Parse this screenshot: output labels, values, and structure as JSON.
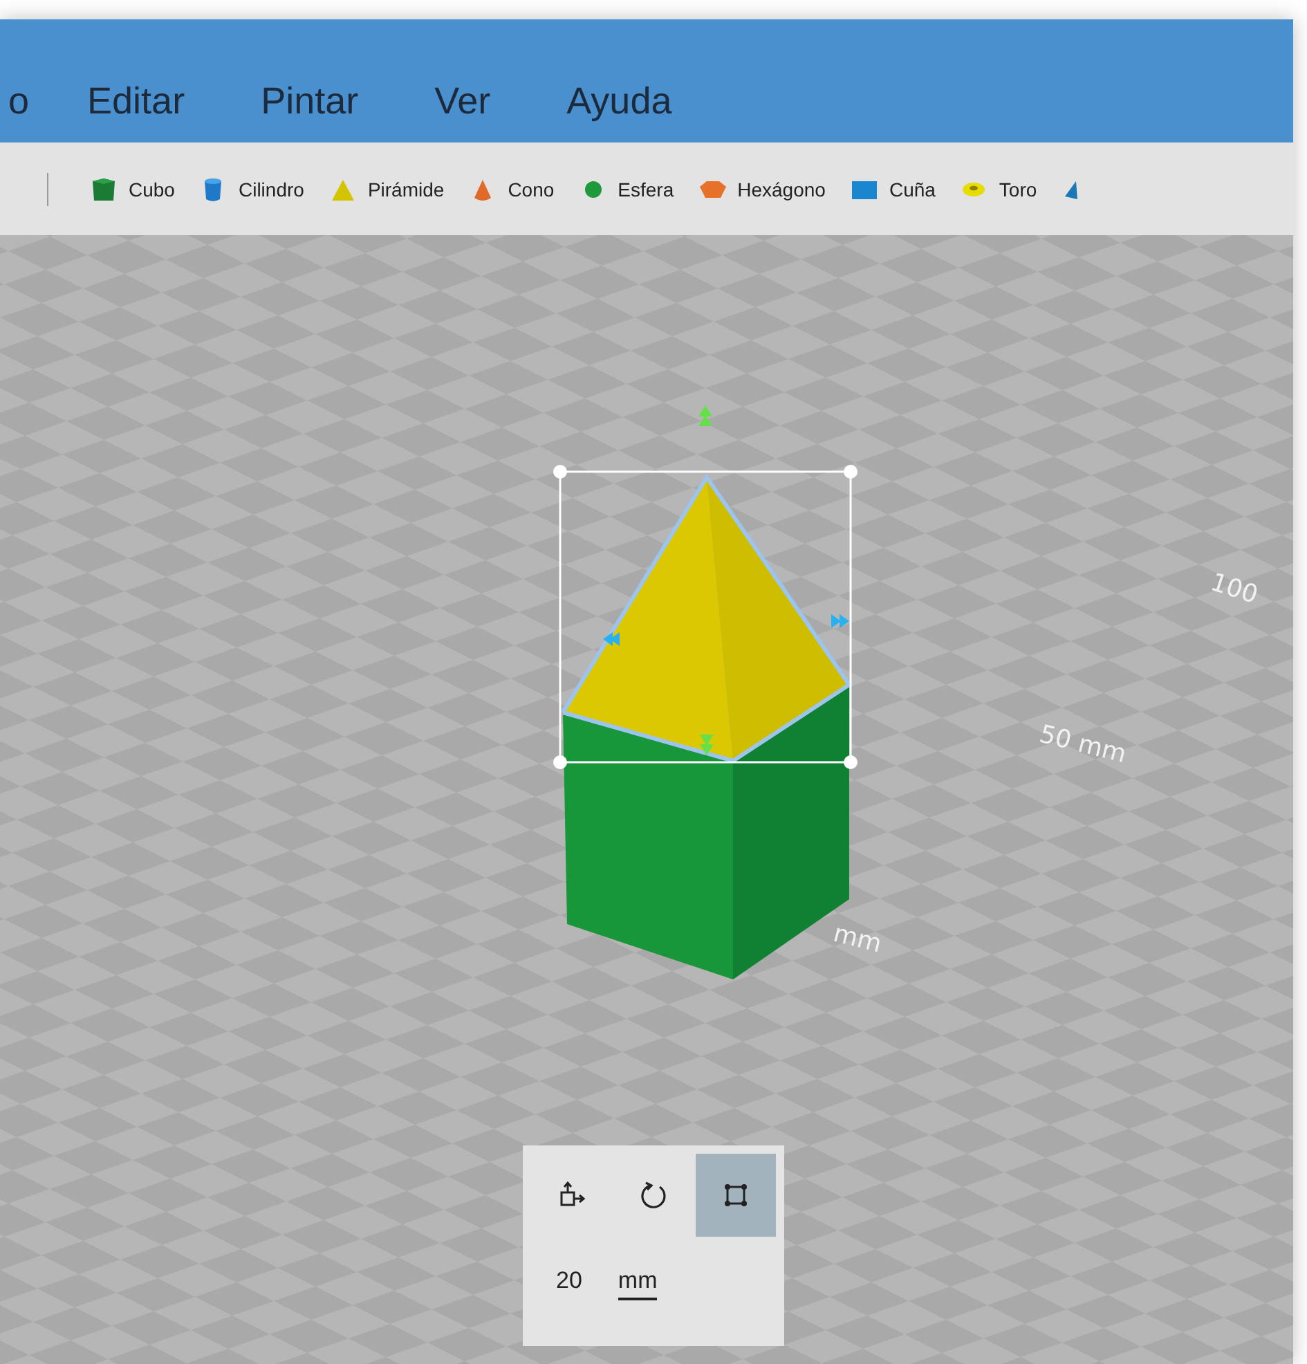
{
  "menu": [
    {
      "label": "o"
    },
    {
      "label": "Editar"
    },
    {
      "label": "Pintar"
    },
    {
      "label": "Ver"
    },
    {
      "label": "Ayuda"
    }
  ],
  "toolbar": {
    "items": [
      {
        "label": "Cubo",
        "kind": "cube"
      },
      {
        "label": "Cilindro",
        "kind": "cylinder"
      },
      {
        "label": "Pirámide",
        "kind": "pyramid"
      },
      {
        "label": "Cono",
        "kind": "cone"
      },
      {
        "label": "Esfera",
        "kind": "sphere"
      },
      {
        "label": "Hexágono",
        "kind": "hexagon"
      },
      {
        "label": "Cuña",
        "kind": "wedge"
      },
      {
        "label": "Toro",
        "kind": "torus"
      }
    ]
  },
  "viewport": {
    "scale_labels": [
      {
        "text": "100"
      },
      {
        "text": "50 mm"
      },
      {
        "text": "mm"
      }
    ]
  },
  "tool_panel": {
    "tools": [
      {
        "kind": "move",
        "selected": false
      },
      {
        "kind": "rotate",
        "selected": false
      },
      {
        "kind": "scale",
        "selected": true
      }
    ],
    "size": {
      "value": "20",
      "unit": "mm"
    }
  }
}
